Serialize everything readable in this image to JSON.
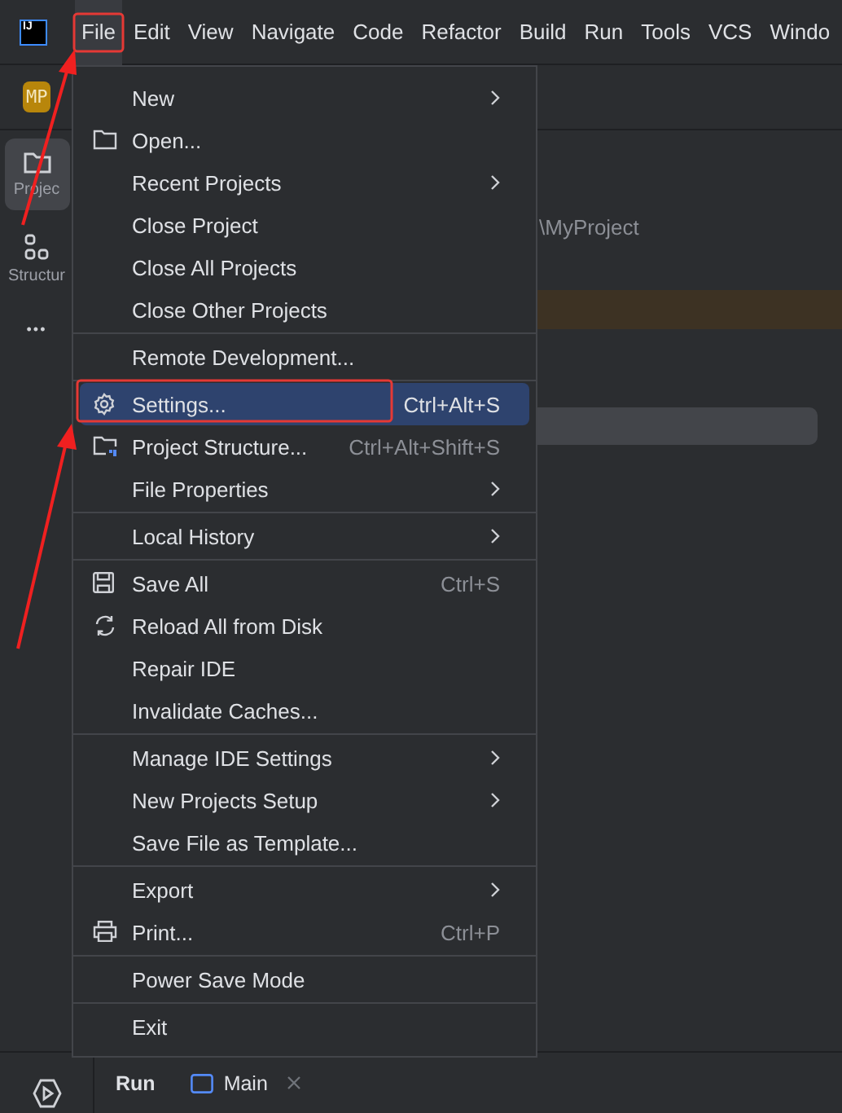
{
  "logo": "IJ",
  "menubar": [
    {
      "label": "File",
      "selected": true
    },
    {
      "label": "Edit",
      "selected": false
    },
    {
      "label": "View",
      "selected": false
    },
    {
      "label": "Navigate",
      "selected": false
    },
    {
      "label": "Code",
      "selected": false
    },
    {
      "label": "Refactor",
      "selected": false
    },
    {
      "label": "Build",
      "selected": false
    },
    {
      "label": "Run",
      "selected": false
    },
    {
      "label": "Tools",
      "selected": false
    },
    {
      "label": "VCS",
      "selected": false
    },
    {
      "label": "Windo",
      "selected": false
    }
  ],
  "project_badge": "MP",
  "sidebar": [
    {
      "label": "Projec",
      "kind": "folder",
      "selected": true
    },
    {
      "label": "Structur",
      "kind": "structure",
      "selected": false
    },
    {
      "label": "•••",
      "kind": "more",
      "selected": false
    }
  ],
  "editor": {
    "path": "\\MyProject"
  },
  "file_menu": {
    "groups": [
      [
        {
          "label": "New",
          "kind": "plain",
          "submenu": true,
          "selected": false
        },
        {
          "label": "Open...",
          "kind": "folder",
          "submenu": false,
          "selected": false
        },
        {
          "label": "Recent Projects",
          "kind": "plain",
          "submenu": true,
          "selected": false
        },
        {
          "label": "Close Project",
          "kind": "plain",
          "submenu": false,
          "selected": false
        },
        {
          "label": "Close All Projects",
          "kind": "plain",
          "submenu": false,
          "selected": false
        },
        {
          "label": "Close Other Projects",
          "kind": "plain",
          "submenu": false,
          "selected": false
        }
      ],
      [
        {
          "label": "Remote Development...",
          "kind": "plain",
          "submenu": false,
          "selected": false
        }
      ],
      [
        {
          "label": "Settings...",
          "kind": "gear",
          "shortcut": "Ctrl+Alt+S",
          "submenu": false,
          "selected": true
        },
        {
          "label": "Project Structure...",
          "kind": "project-folder",
          "shortcut": "Ctrl+Alt+Shift+S",
          "submenu": false,
          "selected": false
        },
        {
          "label": "File Properties",
          "kind": "plain",
          "submenu": true,
          "selected": false
        }
      ],
      [
        {
          "label": "Local History",
          "kind": "plain",
          "submenu": true,
          "selected": false
        }
      ],
      [
        {
          "label": "Save All",
          "kind": "save",
          "shortcut": "Ctrl+S",
          "submenu": false,
          "selected": false
        },
        {
          "label": "Reload All from Disk",
          "kind": "reload",
          "submenu": false,
          "selected": false
        },
        {
          "label": "Repair IDE",
          "kind": "plain",
          "submenu": false,
          "selected": false
        },
        {
          "label": "Invalidate Caches...",
          "kind": "plain",
          "submenu": false,
          "selected": false
        }
      ],
      [
        {
          "label": "Manage IDE Settings",
          "kind": "plain",
          "submenu": true,
          "selected": false
        },
        {
          "label": "New Projects Setup",
          "kind": "plain",
          "submenu": true,
          "selected": false
        },
        {
          "label": "Save File as Template...",
          "kind": "plain",
          "submenu": false,
          "selected": false
        }
      ],
      [
        {
          "label": "Export",
          "kind": "plain",
          "submenu": true,
          "selected": false
        },
        {
          "label": "Print...",
          "kind": "printer",
          "shortcut": "Ctrl+P",
          "submenu": false,
          "selected": false
        }
      ],
      [
        {
          "label": "Power Save Mode",
          "kind": "plain",
          "submenu": false,
          "selected": false
        }
      ],
      [
        {
          "label": "Exit",
          "kind": "plain",
          "submenu": false,
          "selected": false
        }
      ]
    ]
  },
  "bottom_panel": {
    "title": "Run",
    "tabs": [
      {
        "label": "Main",
        "selected": true
      }
    ]
  }
}
